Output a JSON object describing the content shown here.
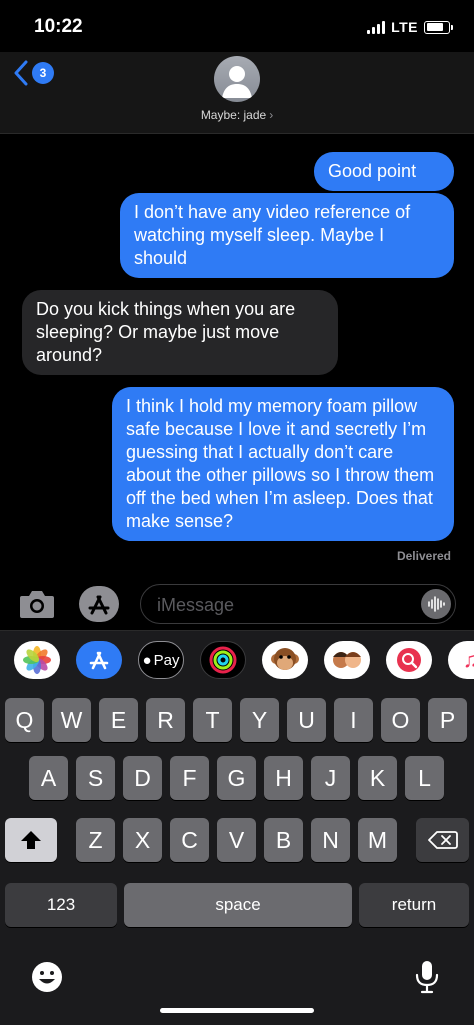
{
  "status": {
    "time": "10:22",
    "network": "LTE"
  },
  "header": {
    "back_count": "3",
    "contact": "Maybe: jade",
    "chevron": "›"
  },
  "messages": [
    {
      "from": "me",
      "text": "Good point"
    },
    {
      "from": "me",
      "text": "I don’t have any video reference of watching myself sleep. Maybe I should"
    },
    {
      "from": "them",
      "text": "Do you kick things when you are sleeping? Or maybe just move around?"
    },
    {
      "from": "me",
      "text": "I think I hold my memory foam pillow safe because I love it and secretly I’m guessing that I actually don’t care about the other pillows so I throw them off the bed when I’m asleep. Does that make sense?"
    }
  ],
  "delivered": "Delivered",
  "input": {
    "placeholder": "iMessage"
  },
  "apps": {
    "applepay_label": "Pay"
  },
  "keyboard": {
    "row1": [
      "Q",
      "W",
      "E",
      "R",
      "T",
      "Y",
      "U",
      "I",
      "O",
      "P"
    ],
    "row2": [
      "A",
      "S",
      "D",
      "F",
      "G",
      "H",
      "J",
      "K",
      "L"
    ],
    "row3": [
      "Z",
      "X",
      "C",
      "V",
      "B",
      "N",
      "M"
    ],
    "numbers": "123",
    "space": "space",
    "return": "return"
  },
  "colors": {
    "outgoing": "#2f7bf5",
    "incoming": "#262628",
    "badge": "#2f7bf5"
  }
}
